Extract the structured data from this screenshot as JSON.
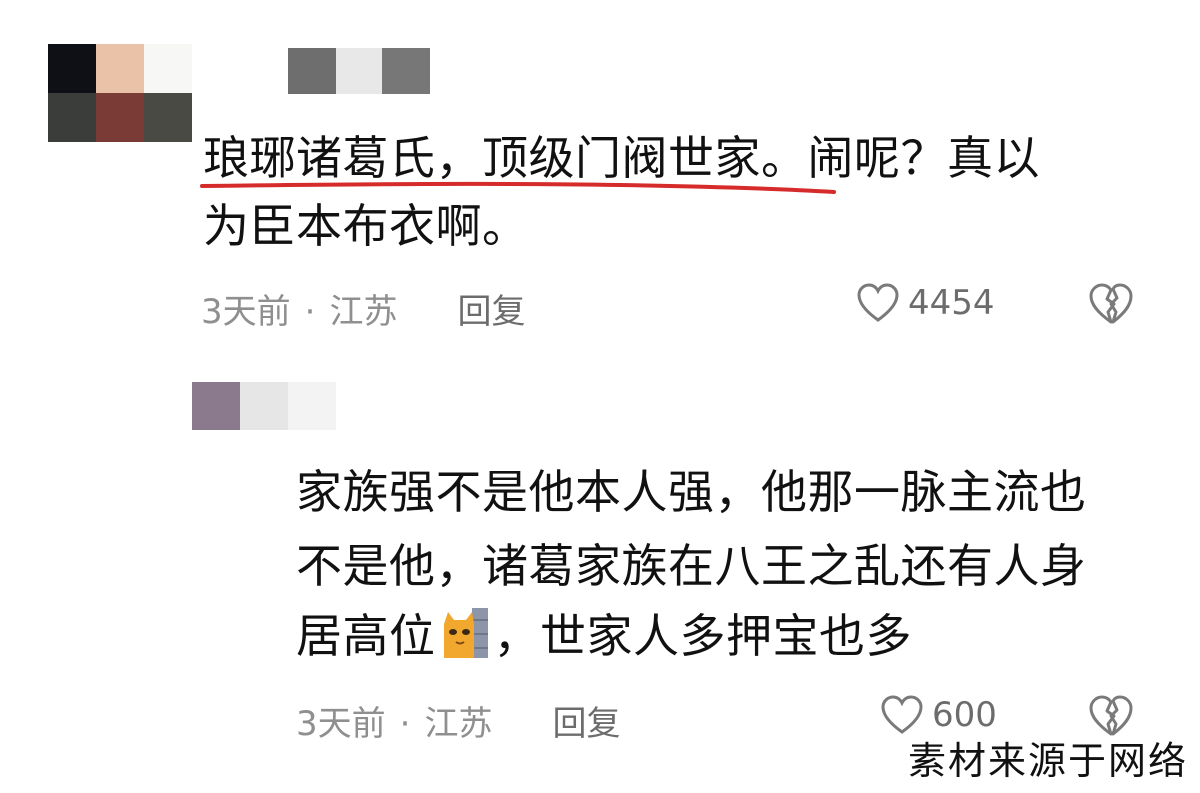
{
  "comments": [
    {
      "text_line1": "琅琊诸葛氏，顶级门阀世家。闹呢？真以",
      "text_line2": "为臣本布衣啊。",
      "time": "3天前",
      "separator": "·",
      "location": "江苏",
      "reply_label": "回复",
      "like_count": "4454"
    },
    {
      "text_line1": "家族强不是他本人强，他那一脉主流也",
      "text_line2": "不是他，诸葛家族在八王之乱还有人身",
      "text_line3_before": "居高位",
      "text_line3_after": "，世家人多押宝也多",
      "time": "3天前",
      "separator": "·",
      "location": "江苏",
      "reply_label": "回复",
      "like_count": "600"
    }
  ],
  "watermark": "素材来源于网络",
  "colors": {
    "underline": "#d62b2b",
    "meta_text": "#8f8f8f",
    "icon": "#7a7a7a"
  },
  "icons": [
    "heart-outline-icon",
    "broken-heart-icon",
    "cat-emoji-icon"
  ]
}
